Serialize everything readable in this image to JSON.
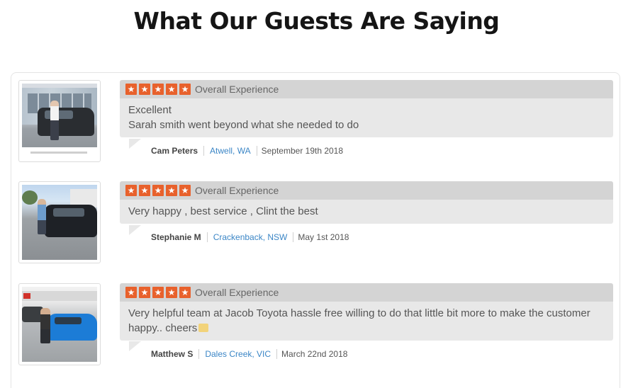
{
  "page": {
    "title": "What Our Guests Are Saying"
  },
  "theme": {
    "star_color": "#e8612c",
    "link_color": "#3b86c6",
    "title_color": "#151515"
  },
  "reviews": [
    {
      "stars": 5,
      "rating_label": "Overall Experience",
      "title": "Excellent",
      "text": "Sarah smith went beyond what she needed to do",
      "author": "Cam Peters",
      "location": "Atwell, WA",
      "date": "September 19th 2018"
    },
    {
      "stars": 5,
      "rating_label": "Overall Experience",
      "title": "",
      "text": "Very happy , best service , Clint the best",
      "author": "Stephanie M",
      "location": "Crackenback, NSW",
      "date": "May 1st 2018"
    },
    {
      "stars": 5,
      "rating_label": "Overall Experience",
      "title": "",
      "text": "Very helpful team at Jacob Toyota hassle free willing to do that little bit more to make the customer happy.. cheers",
      "author": "Matthew S",
      "location": "Dales Creek, VIC",
      "date": "March 22nd 2018"
    }
  ]
}
